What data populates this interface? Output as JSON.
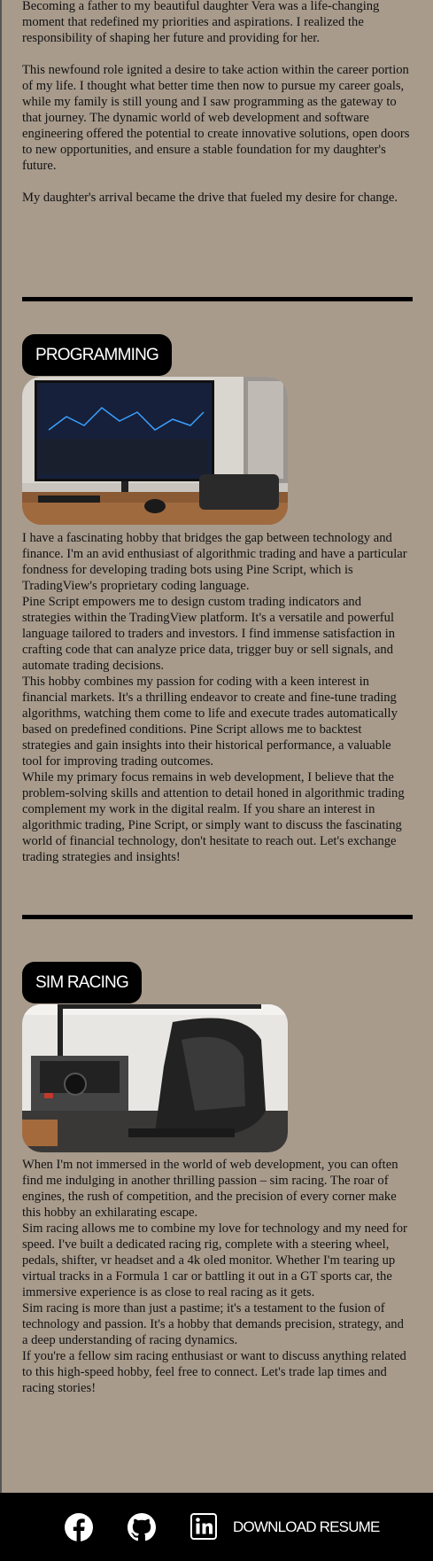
{
  "intro": {
    "paragraphs": [
      "Becoming a father to my beautiful daughter Vera was a life-changing moment that redefined my priorities and aspirations. I realized the responsibility of shaping her future and providing for her.",
      "This newfound role ignited a desire to take action within the career portion of my life. I thought what better time then now to pursue my career goals, while my family is still young and I saw programming as the gateway to that journey. The dynamic world of web development and software engineering offered the potential to create innovative solutions, open doors to new opportunities, and ensure a stable foundation for my daughter's future.",
      "My daughter's arrival became the drive that fueled my desire for change."
    ]
  },
  "programming": {
    "label": "PROGRAMMING",
    "paragraphs": [
      "I have a fascinating hobby that bridges the gap between technology and finance. I'm an avid enthusiast of algorithmic trading and have a particular fondness for developing trading bots using Pine Script, which is TradingView's proprietary coding language.",
      "Pine Script empowers me to design custom trading indicators and strategies within the TradingView platform. It's a versatile and powerful language tailored to traders and investors. I find immense satisfaction in crafting code that can analyze price data, trigger buy or sell signals, and automate trading decisions.",
      "This hobby combines my passion for coding with a keen interest in financial markets. It's a thrilling endeavor to create and fine-tune trading algorithms, watching them come to life and execute trades automatically based on predefined conditions. Pine Script allows me to backtest strategies and gain insights into their historical performance, a valuable tool for improving trading outcomes.",
      "While my primary focus remains in web development, I believe that the problem-solving skills and attention to detail honed in algorithmic trading complement my work in the digital realm. If you share an interest in algorithmic trading, Pine Script, or simply want to discuss the fascinating world of financial technology, don't hesitate to reach out. Let's exchange trading strategies and insights!"
    ]
  },
  "simracing": {
    "label": "SIM RACING",
    "paragraphs": [
      "When I'm not immersed in the world of web development, you can often find me indulging in another thrilling passion – sim racing. The roar of engines, the rush of competition, and the precision of every corner make this hobby an exhilarating escape.",
      "Sim racing allows me to combine my love for technology and my need for speed. I've built a dedicated racing rig, complete with a steering wheel, pedals, shifter, vr headset and a 4k oled monitor. Whether I'm tearing up virtual tracks in a Formula 1 car or battling it out in a GT sports car, the immersive experience is as close to real racing as it gets.",
      "Sim racing is more than just a pastime; it's a testament to the fusion of technology and passion. It's a hobby that demands precision, strategy, and a deep understanding of racing dynamics.",
      "If you're a fellow sim racing enthusiast or want to discuss anything related to this high-speed hobby, feel free to connect. Let's trade lap times and racing stories!"
    ]
  },
  "footer": {
    "download_label": "DOWNLOAD RESUME",
    "icons": [
      "facebook-icon",
      "github-icon",
      "linkedin-icon"
    ]
  },
  "colors": {
    "background": "#a89b8c",
    "footer": "#000000",
    "label_bg": "#000000"
  }
}
